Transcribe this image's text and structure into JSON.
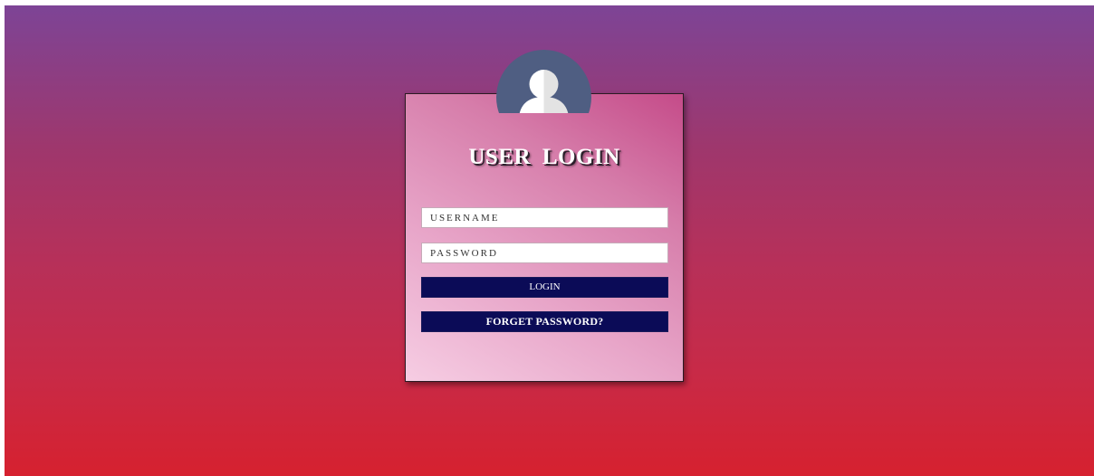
{
  "login": {
    "title": "USER  LOGIN",
    "username_placeholder": "USERNAME",
    "password_placeholder": "PASSWORD",
    "login_label": "LOGIN",
    "forget_label": "FORGET PASSWORD?"
  },
  "icons": {
    "avatar": "user-icon"
  },
  "colors": {
    "background_top": "#7d4496",
    "background_bottom": "#d6212f",
    "button": "#0b0b57",
    "avatar": "#4f5e82"
  }
}
